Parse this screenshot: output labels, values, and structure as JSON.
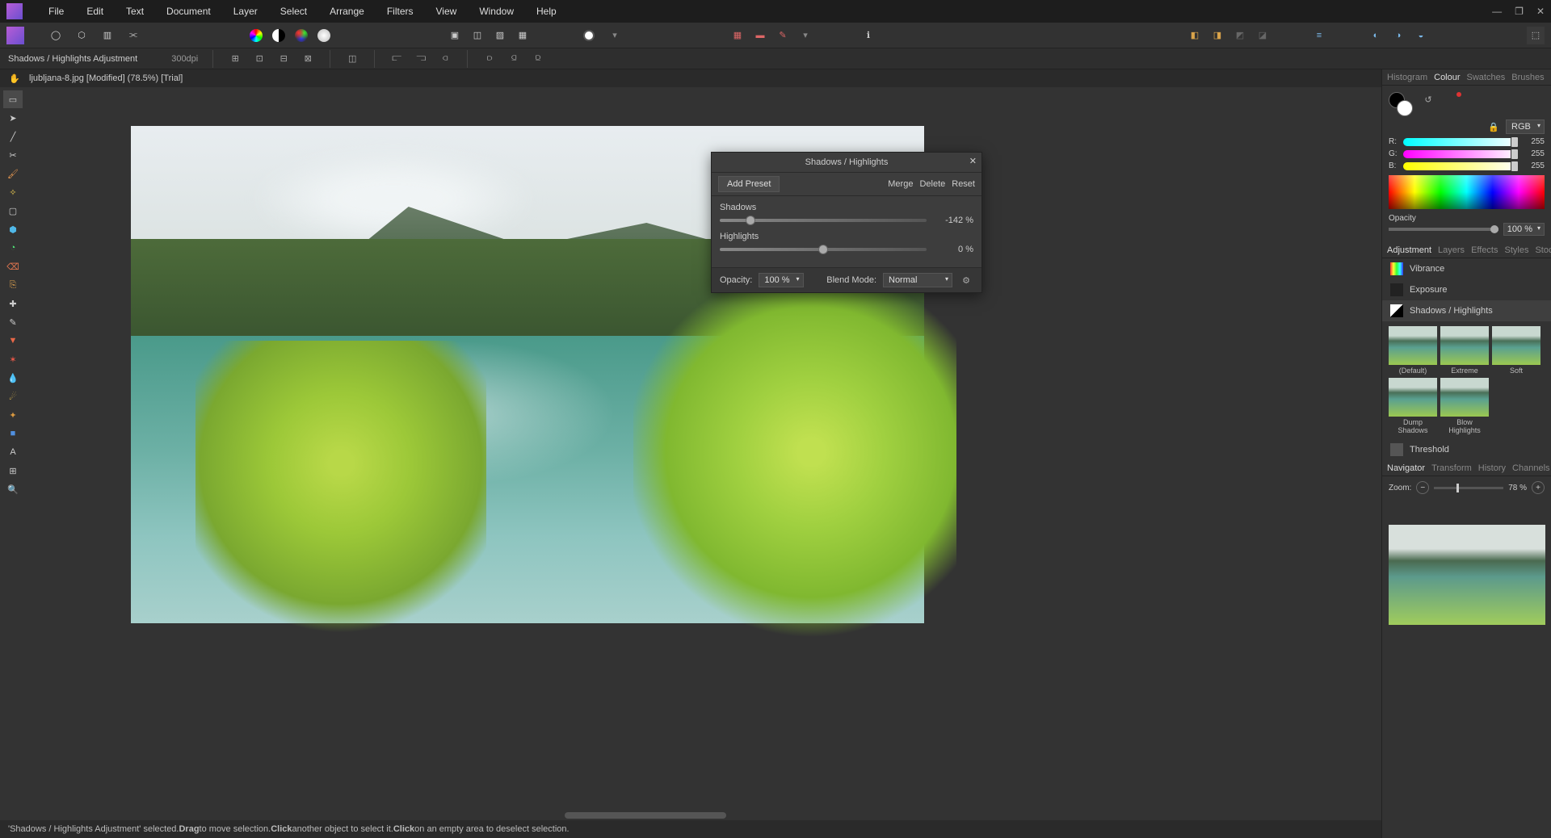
{
  "menu": [
    "File",
    "Edit",
    "Text",
    "Document",
    "Layer",
    "Select",
    "Arrange",
    "Filters",
    "View",
    "Window",
    "Help"
  ],
  "context": {
    "title": "Shadows / Highlights Adjustment",
    "dpi": "300dpi"
  },
  "tab": "ljubljana-8.jpg [Modified] (78.5%) [Trial]",
  "dialog": {
    "title": "Shadows / Highlights",
    "addPreset": "Add Preset",
    "merge": "Merge",
    "delete": "Delete",
    "reset": "Reset",
    "shadowsLabel": "Shadows",
    "shadowsValue": "-142 %",
    "shadowsPos": 15,
    "highlightsLabel": "Highlights",
    "highlightsValue": "0 %",
    "highlightsPos": 50,
    "opacityLabel": "Opacity:",
    "opacityValue": "100 %",
    "blendLabel": "Blend Mode:",
    "blendValue": "Normal"
  },
  "rightTabsA": [
    "Histogram",
    "Colour",
    "Swatches",
    "Brushes"
  ],
  "rightTabsA_active": 1,
  "colour": {
    "mode": "RGB",
    "r": "255",
    "g": "255",
    "b": "255",
    "opacityLabel": "Opacity",
    "opacityValue": "100 %"
  },
  "rightTabsB": [
    "Adjustment",
    "Layers",
    "Effects",
    "Styles",
    "Stock"
  ],
  "rightTabsB_active": 0,
  "adjustments": [
    "Vibrance",
    "Exposure",
    "Shadows / Highlights"
  ],
  "adjustments_sel": 2,
  "presets": [
    "(Default)",
    "Extreme",
    "Soft",
    "Dump Shadows",
    "Blow Highlights"
  ],
  "threshold": "Threshold",
  "rightTabsC": [
    "Navigator",
    "Transform",
    "History",
    "Channels"
  ],
  "rightTabsC_active": 0,
  "navigator": {
    "zoomLabel": "Zoom:",
    "zoomValue": "78 %"
  },
  "status": {
    "p1": "'Shadows / Highlights Adjustment' selected. ",
    "b1": "Drag",
    "p2": " to move selection. ",
    "b2": "Click",
    "p3": " another object to select it. ",
    "b3": "Click",
    "p4": " on an empty area to deselect selection."
  }
}
